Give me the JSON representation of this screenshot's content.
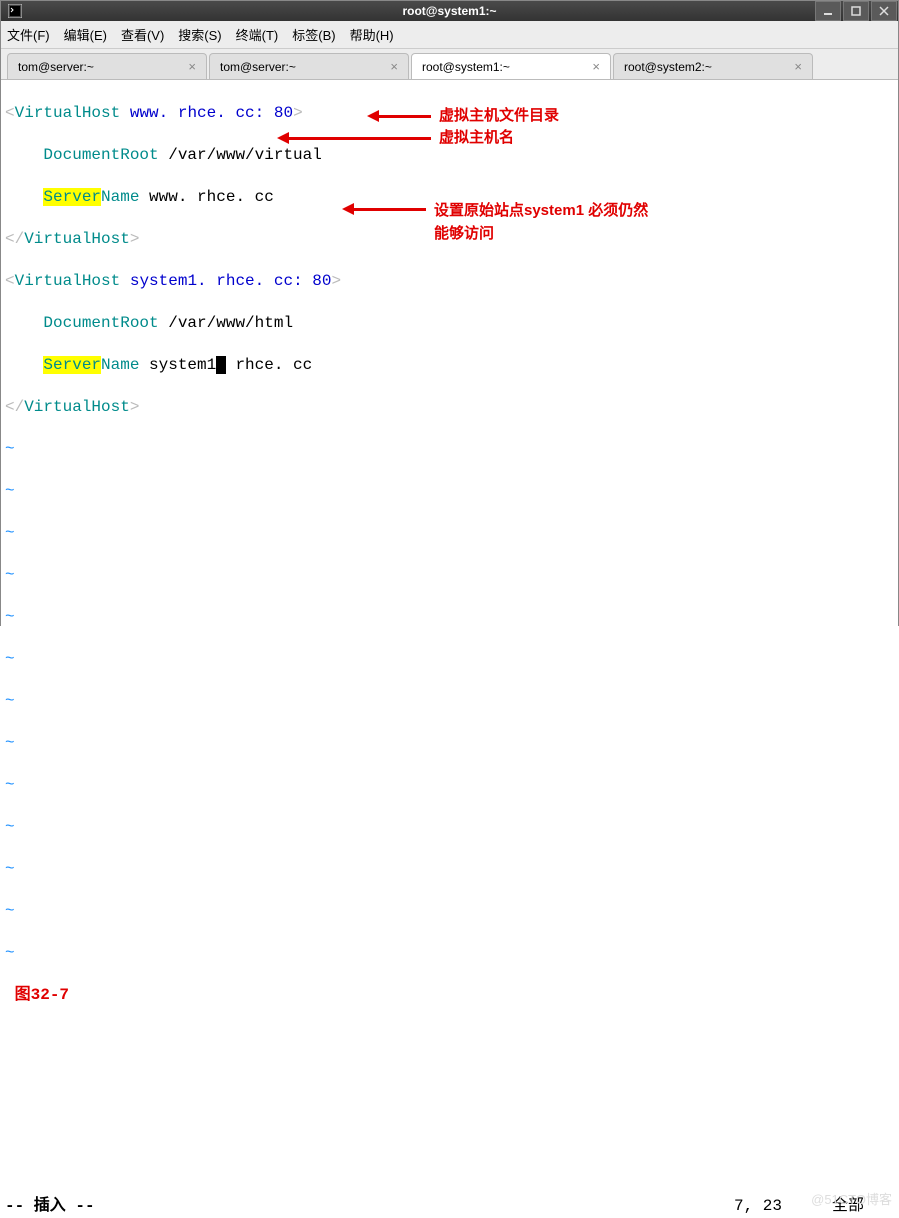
{
  "window": {
    "title": "root@system1:~"
  },
  "menubar": {
    "file": "文件(F)",
    "edit": "编辑(E)",
    "view": "查看(V)",
    "search": "搜索(S)",
    "terminal": "终端(T)",
    "tabs": "标签(B)",
    "help": "帮助(H)"
  },
  "tabs": [
    {
      "label": "tom@server:~",
      "active": false
    },
    {
      "label": "tom@server:~",
      "active": false
    },
    {
      "label": "root@system1:~",
      "active": true
    },
    {
      "label": "root@system2:~",
      "active": false
    }
  ],
  "editor": {
    "vh1_open_tag": "VirtualHost",
    "vh1_open_attr": " www. rhce. cc: 80",
    "vh1_docroot_key": "DocumentRoot",
    "vh1_docroot_val": " /var/www/virtual",
    "vh1_servername_key_hl": "Server",
    "vh1_servername_key_rest": "Name",
    "vh1_servername_val": " www. rhce. cc",
    "vh1_close_tag": "VirtualHost",
    "vh2_open_tag": "VirtualHost",
    "vh2_open_attr": " system1. rhce. cc: 80",
    "vh2_docroot_key": "DocumentRoot",
    "vh2_docroot_val": " /var/www/html",
    "vh2_servername_key_hl": "Server",
    "vh2_servername_key_rest": "Name",
    "vh2_servername_val_pre": " system1",
    "vh2_servername_val_post": " rhce. cc",
    "vh2_close_tag": "VirtualHost",
    "figure_label": "图32-7"
  },
  "status": {
    "mode": "-- 插入 --",
    "position": "7, 23",
    "scroll": "全部"
  },
  "annotations": {
    "a1": "虚拟主机文件目录",
    "a2": "虚拟主机名",
    "a3_l1": "设置原始站点system1 必须仍然",
    "a3_l2": "能够访问"
  },
  "watermark": "@51CTO博客"
}
